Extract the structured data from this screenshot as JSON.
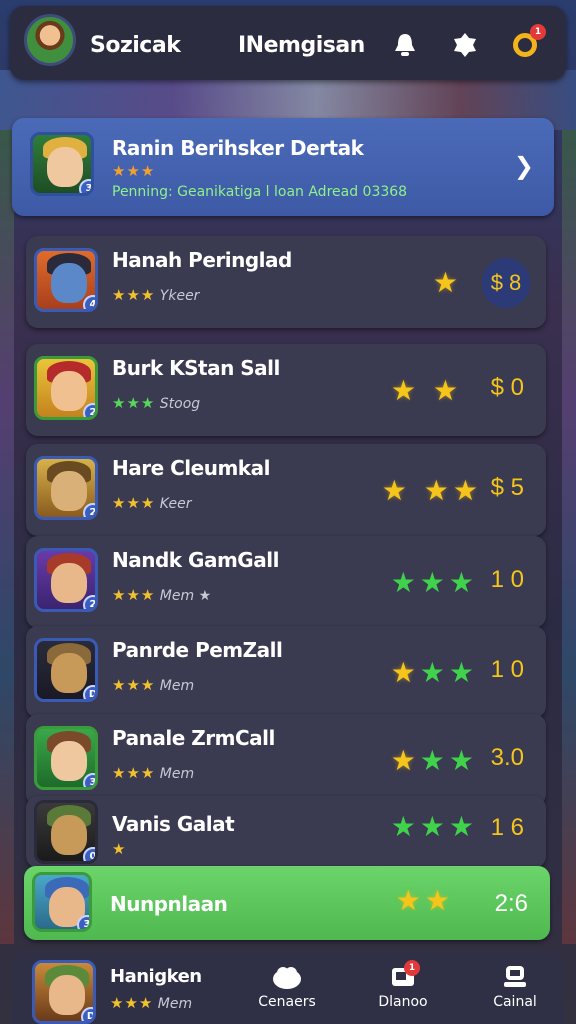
{
  "header": {
    "left_title": "Sozicak",
    "center_title": "INemgisan",
    "notification_count": "1"
  },
  "featured": {
    "name": "Ranin Berihsker Dertak",
    "stars": "★★★",
    "subtitle": "Penning: Geanikatiga l loan Adread 03368",
    "level": "3"
  },
  "rows": [
    {
      "name": "Hanah Peringlad",
      "stars": "★★★",
      "tag": "Ykeer",
      "level": "4",
      "right_stars": "★",
      "value": "$ 8"
    },
    {
      "name": "Burk KStan Sall",
      "stars": "★★★",
      "tag": "Stoog",
      "level": "2",
      "right_stars": "★ ★",
      "value": "$ 0"
    },
    {
      "name": "Hare Cleumkal",
      "stars": "★★★",
      "tag": "Keer",
      "level": "2",
      "right_stars": "★ ★★",
      "value": "$ 5"
    },
    {
      "name": "Nandk GamGall",
      "stars": "★★★",
      "tag": "Mem ★",
      "level": "2",
      "right_stars": "★★★",
      "value": "1 0"
    },
    {
      "name": "Panrde PemZall",
      "stars": "★★★",
      "tag": "Mem",
      "level": "D",
      "right_stars": "★★★",
      "value": "1 0"
    },
    {
      "name": "Panale ZrmCall",
      "stars": "★★★",
      "tag": "Mem",
      "level": "3",
      "right_stars": "★★★",
      "value": "3.0"
    },
    {
      "name": "Vanis Galat",
      "stars": "★",
      "tag": "",
      "level": "0",
      "right_stars": "★★★",
      "value": "1 6"
    }
  ],
  "active_row": {
    "name": "Nunpnlaan",
    "level": "3",
    "right_stars": "★★",
    "value": "2:6"
  },
  "bottom": {
    "profile_name": "Hanigken",
    "profile_stars": "★★★",
    "profile_tag": "Mem",
    "profile_level": "D",
    "nav": [
      {
        "label": "Cenaers",
        "icon": "cloud-icon"
      },
      {
        "label": "Dlanoo",
        "icon": "chat-icon",
        "badge": "1"
      },
      {
        "label": "Cainal",
        "icon": "profile-icon"
      }
    ]
  },
  "colors": {
    "gold_star": "#f5c51b",
    "green_star": "#3fd24a",
    "featured_bg": "#4a6ab8",
    "active_bg": "#6bd46a",
    "row_bg": "#3a3a50"
  }
}
